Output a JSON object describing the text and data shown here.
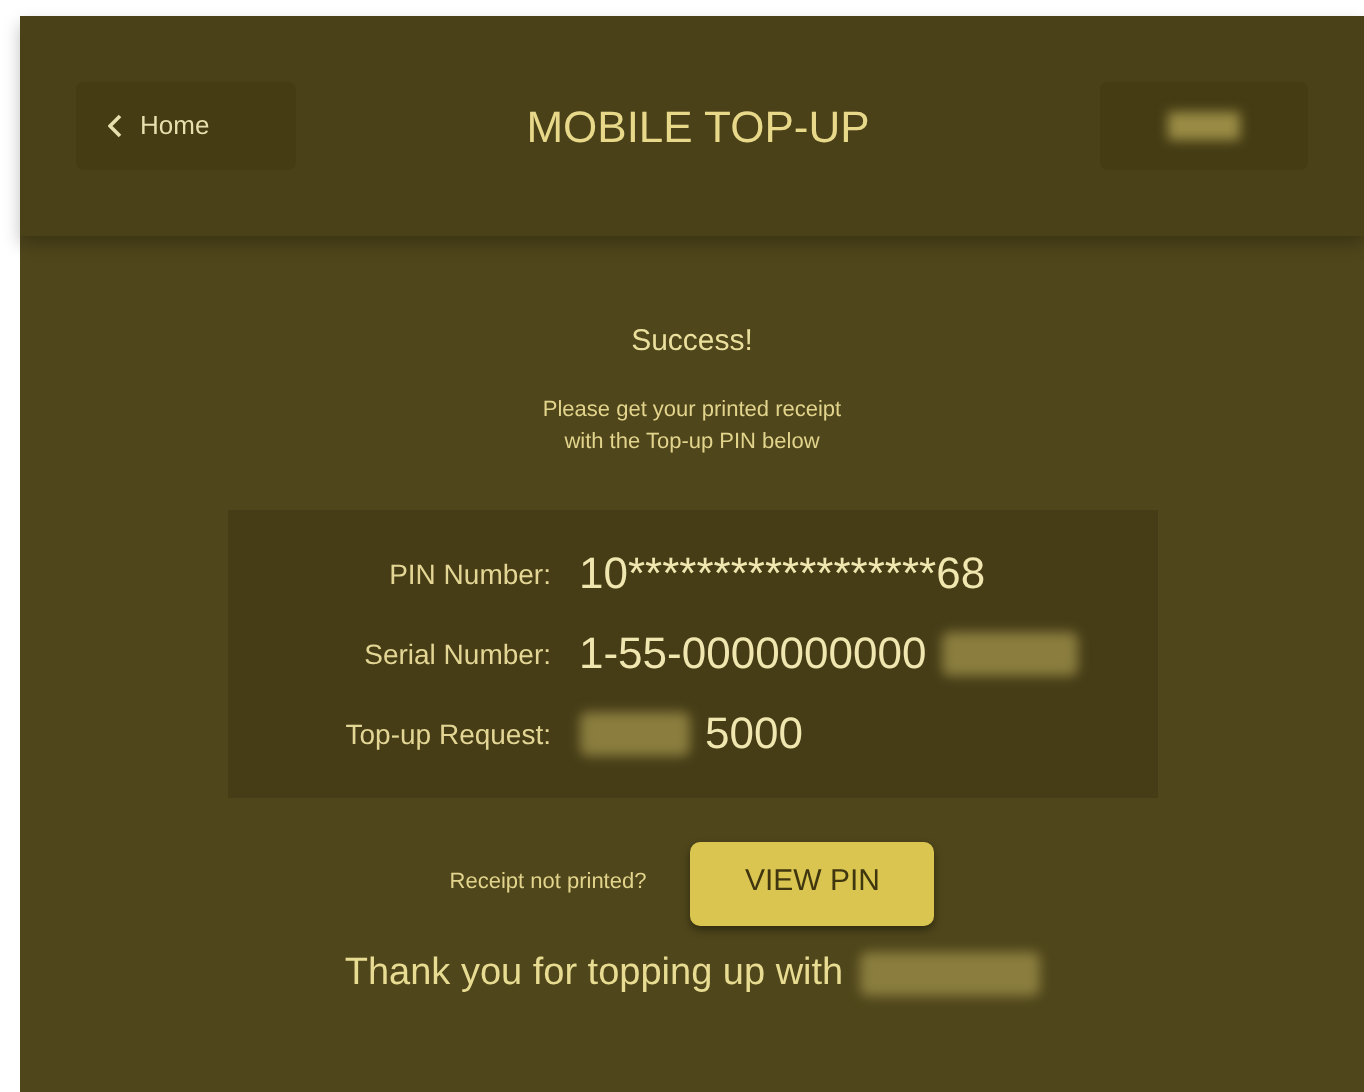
{
  "header": {
    "back_label": "Home",
    "title": "MOBILE TOP-UP"
  },
  "message": {
    "title": "Success!",
    "lines": [
      "Please get your printed receipt",
      "with the Top-up PIN below"
    ]
  },
  "details": [
    {
      "label": "PIN Number:",
      "parts": [
        {
          "kind": "text",
          "value": "10******************68"
        }
      ]
    },
    {
      "label": "Serial Number:",
      "parts": [
        {
          "kind": "text",
          "value": "1-55-0000000000"
        },
        {
          "kind": "redacted"
        }
      ]
    },
    {
      "label": "Top-up Request:",
      "parts": [
        {
          "kind": "redacted"
        },
        {
          "kind": "text",
          "value": "5000"
        }
      ]
    }
  ],
  "receipt_prompt": "Receipt not printed?",
  "view_button": "VIEW PIN",
  "thanks": "Thank you for topping up with"
}
